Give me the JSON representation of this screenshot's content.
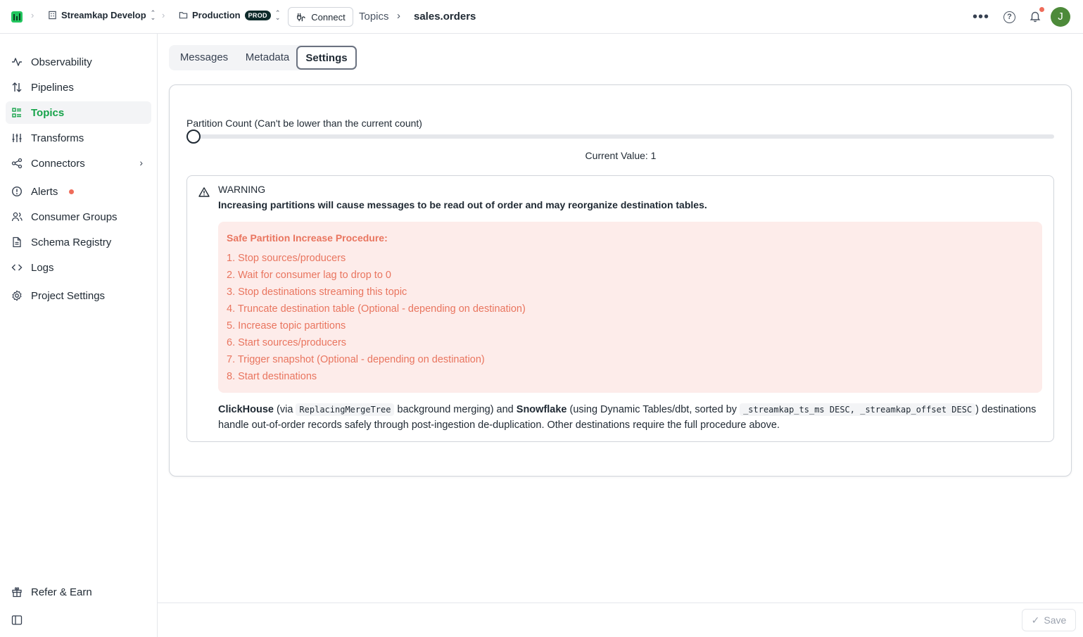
{
  "header": {
    "org_name": "Streamkap Develop",
    "env_name": "Production",
    "env_badge": "PROD",
    "connect_label": "Connect",
    "breadcrumb_section": "Topics",
    "breadcrumb_current": "sales.orders",
    "avatar_initial": "J",
    "brand_color": "#22c55e"
  },
  "sidebar": {
    "items": [
      {
        "label": "Observability",
        "icon": "activity-icon"
      },
      {
        "label": "Pipelines",
        "icon": "arrows-updown-icon"
      },
      {
        "label": "Topics",
        "icon": "list-icon",
        "active": true
      },
      {
        "label": "Transforms",
        "icon": "sliders-icon"
      },
      {
        "label": "Connectors",
        "icon": "share-icon"
      },
      {
        "label": "Alerts",
        "icon": "alert-circle-icon"
      },
      {
        "label": "Consumer Groups",
        "icon": "users-icon"
      },
      {
        "label": "Schema Registry",
        "icon": "file-icon"
      },
      {
        "label": "Logs",
        "icon": "code-icon"
      },
      {
        "label": "Project Settings",
        "icon": "gear-icon"
      }
    ],
    "refer_label": "Refer & Earn",
    "active_color": "#16a34a"
  },
  "tabs": [
    "Messages",
    "Metadata",
    "Settings"
  ],
  "active_tab": "Settings",
  "settings": {
    "partition_label": "Partition Count (Can't be lower than the current count)",
    "current_value_text": "Current Value: 1",
    "current_value": 1,
    "warning_title": "WARNING",
    "warning_text": "Increasing partitions will cause messages to be read out of order and may reorganize destination tables.",
    "procedure_title": "Safe Partition Increase Procedure:",
    "steps": [
      "1. Stop sources/producers",
      "2. Wait for consumer lag to drop to 0",
      "3. Stop destinations streaming this topic",
      "4. Truncate destination table (Optional - depending on destination)",
      "5. Increase topic partitions",
      "6. Start sources/producers",
      "7. Trigger snapshot (Optional - depending on destination)",
      "8. Start destinations"
    ],
    "note": {
      "clickhouse": "ClickHouse",
      "via": "(via",
      "code1": "ReplacingMergeTree",
      "after_code1": "background merging) and",
      "snowflake": "Snowflake",
      "using": "(using Dynamic Tables/dbt, sorted by",
      "code2": "_streamkap_ts_ms DESC, _streamkap_offset DESC",
      "close": ")",
      "rest": "destinations handle out-of-order records safely through post-ingestion de-duplication. Other destinations require the full procedure above."
    },
    "procedure_color": "#e9755f"
  },
  "footer": {
    "save_label": "Save"
  }
}
